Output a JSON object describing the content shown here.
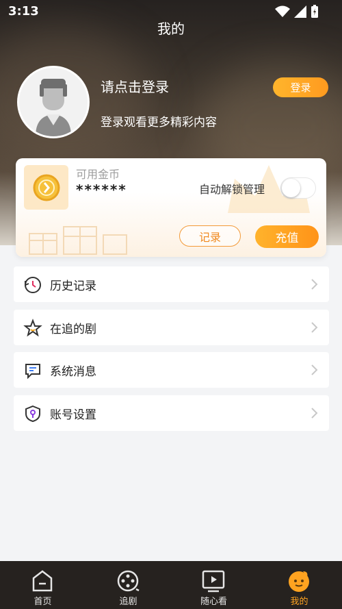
{
  "status_bar": {
    "time": "3:13"
  },
  "page": {
    "title": "我的"
  },
  "profile": {
    "login_prompt": "请点击登录",
    "login_subtitle": "登录观看更多精彩内容",
    "login_button": "登录"
  },
  "coins": {
    "label": "可用金币",
    "value": "******",
    "auto_unlock_label": "自动解锁管理",
    "auto_unlock_on": false,
    "record_button": "记录",
    "recharge_button": "充值"
  },
  "menu": [
    {
      "label": "历史记录",
      "icon": "history-icon"
    },
    {
      "label": "在追的剧",
      "icon": "star-icon"
    },
    {
      "label": "系统消息",
      "icon": "message-icon"
    },
    {
      "label": "账号设置",
      "icon": "shield-icon"
    }
  ],
  "tabs": [
    {
      "label": "首页",
      "icon": "home-icon"
    },
    {
      "label": "追剧",
      "icon": "film-reel-icon"
    },
    {
      "label": "随心看",
      "icon": "play-screen-icon"
    },
    {
      "label": "我的",
      "icon": "profile-mascot-icon",
      "active": true
    }
  ],
  "colors": {
    "accent": "#ff9a1f",
    "tab_bar": "#26221f",
    "background": "#f3f4f6"
  }
}
